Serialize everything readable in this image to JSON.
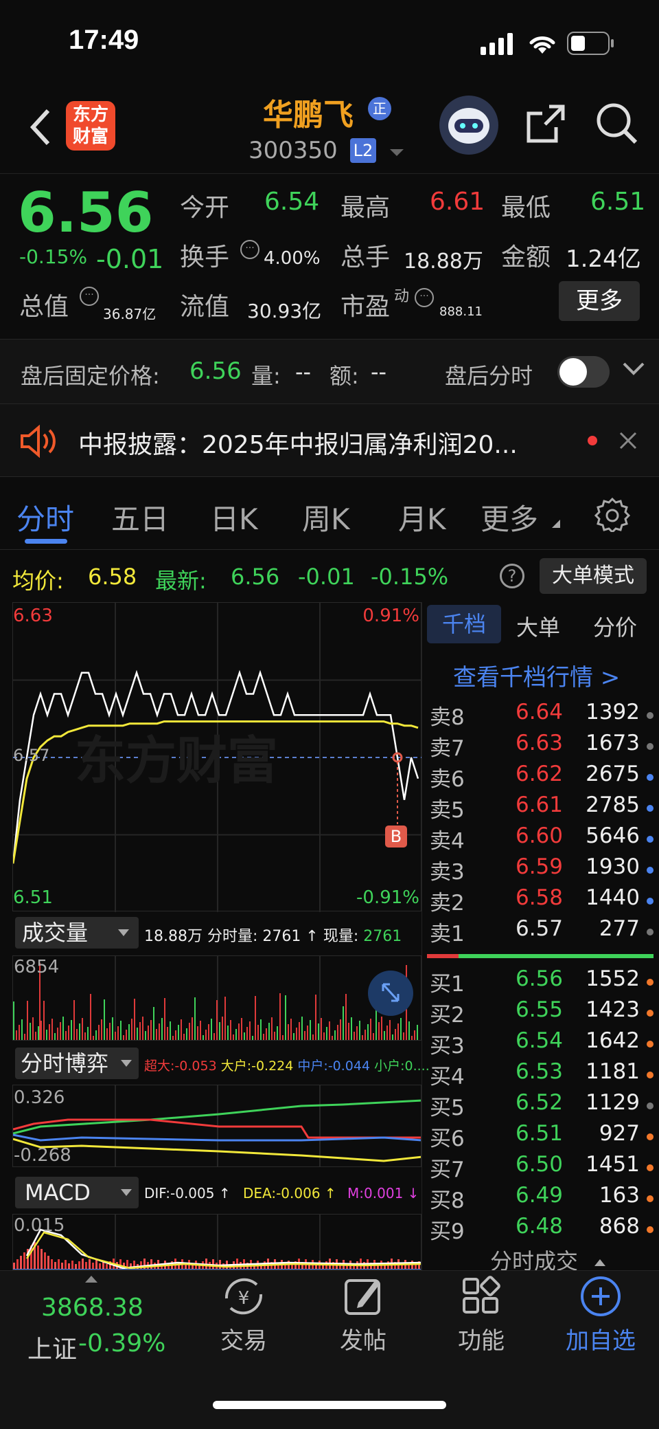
{
  "status": {
    "time": "17:49"
  },
  "header": {
    "logo_line1": "东方",
    "logo_line2": "财富",
    "stock_name": "华鹏飞",
    "badge": "正",
    "code": "300350",
    "level": "L2"
  },
  "quote": {
    "price": "6.56",
    "pct": "-0.15%",
    "chg": "-0.01",
    "open_label": "今开",
    "open": "6.54",
    "high_label": "最高",
    "high": "6.61",
    "low_label": "最低",
    "low": "6.51",
    "turnover_label": "换手",
    "turnover": "4.00%",
    "vol_label": "总手",
    "vol": "18.88万",
    "amount_label": "金额",
    "amount": "1.24亿",
    "mcap_label": "总值",
    "mcap": "36.87亿",
    "float_label": "流值",
    "float": "30.93亿",
    "pe_label": "市盈",
    "pe_sup": "动",
    "pe": "888.11",
    "more": "更多"
  },
  "afterhours": {
    "label": "盘后固定价格:",
    "price": "6.56",
    "vol_label": "量:",
    "vol": "--",
    "amt_label": "额:",
    "amt": "--",
    "fenshi": "盘后分时"
  },
  "notice": {
    "text": "中报披露：2025年中报归属净利润20..."
  },
  "tabs": [
    "分时",
    "五日",
    "日K",
    "周K",
    "月K",
    "更多"
  ],
  "infobar": {
    "avg_label": "均价:",
    "avg": "6.58",
    "latest_label": "最新:",
    "latest": "6.56",
    "chg": "-0.01",
    "pct": "-0.15%",
    "mode": "大单模式"
  },
  "chart_data": [
    {
      "type": "line",
      "title": "分时",
      "ylim": [
        6.51,
        6.63
      ],
      "y_labels": {
        "top": "6.63",
        "mid": "6.57",
        "bottom": "6.51",
        "top_pct": "0.91%",
        "bottom_pct": "-0.91%"
      },
      "series": [
        {
          "name": "price",
          "color": "#ffffff",
          "values": [
            6.52,
            6.55,
            6.57,
            6.59,
            6.6,
            6.59,
            6.6,
            6.6,
            6.59,
            6.6,
            6.61,
            6.61,
            6.6,
            6.6,
            6.59,
            6.6,
            6.59,
            6.6,
            6.61,
            6.6,
            6.6,
            6.59,
            6.6,
            6.6,
            6.59,
            6.59,
            6.6,
            6.59,
            6.59,
            6.6,
            6.59,
            6.59,
            6.6,
            6.61,
            6.6,
            6.6,
            6.61,
            6.6,
            6.59,
            6.59,
            6.6,
            6.59,
            6.59,
            6.59,
            6.59,
            6.59,
            6.59,
            6.59,
            6.59,
            6.59,
            6.59,
            6.59,
            6.6,
            6.59,
            6.59,
            6.59,
            6.57,
            6.55,
            6.57,
            6.56
          ]
        },
        {
          "name": "avg",
          "color": "#f2e83a",
          "values": [
            6.52,
            6.54,
            6.56,
            6.57,
            6.575,
            6.578,
            6.58,
            6.58,
            6.582,
            6.583,
            6.584,
            6.585,
            6.585,
            6.585,
            6.585,
            6.585,
            6.585,
            6.586,
            6.586,
            6.586,
            6.586,
            6.586,
            6.587,
            6.587,
            6.587,
            6.587,
            6.587,
            6.587,
            6.587,
            6.587,
            6.587,
            6.587,
            6.587,
            6.587,
            6.587,
            6.587,
            6.587,
            6.587,
            6.587,
            6.587,
            6.587,
            6.587,
            6.587,
            6.587,
            6.587,
            6.587,
            6.587,
            6.587,
            6.587,
            6.587,
            6.587,
            6.587,
            6.587,
            6.587,
            6.587,
            6.586,
            6.586,
            6.585,
            6.585,
            6.584
          ]
        }
      ],
      "marker": "B"
    },
    {
      "type": "bar",
      "title": "成交量",
      "ymax_label": "6854",
      "summary": "18.88万",
      "period_label": "分时量:",
      "period": "2761",
      "now_label": "现量:",
      "now": "2761"
    },
    {
      "type": "line",
      "title": "分时博弈",
      "ymax": "0.326",
      "ymin": "-0.268",
      "legend": [
        {
          "name": "超大:",
          "value": "-0.053",
          "color": "#f23b3b"
        },
        {
          "name": "大户:",
          "value": "-0.224",
          "color": "#f2e83a"
        },
        {
          "name": "中户:",
          "value": "-0.044",
          "color": "#4b84f0"
        },
        {
          "name": "小户:",
          "value": "0....",
          "color": "#3fd35a"
        }
      ]
    },
    {
      "type": "bar",
      "title": "MACD",
      "dif_label": "DIF:",
      "dif": "-0.005",
      "dea_label": "DEA:",
      "dea": "-0.006",
      "m_label": "M:",
      "m": "0.001",
      "ymax": "0.015"
    }
  ],
  "orderbook": {
    "tabs": [
      "千档",
      "大单",
      "分价"
    ],
    "link": "查看千档行情 >",
    "asks": [
      {
        "l": "卖8",
        "p": "6.64",
        "v": "1392",
        "c": "#f23b3b",
        "d": "#777"
      },
      {
        "l": "卖7",
        "p": "6.63",
        "v": "1673",
        "c": "#f23b3b",
        "d": "#777"
      },
      {
        "l": "卖6",
        "p": "6.62",
        "v": "2675",
        "c": "#f23b3b",
        "d": "#4b84f0"
      },
      {
        "l": "卖5",
        "p": "6.61",
        "v": "2785",
        "c": "#f23b3b",
        "d": "#4b84f0"
      },
      {
        "l": "卖4",
        "p": "6.60",
        "v": "5646",
        "c": "#f23b3b",
        "d": "#4b84f0"
      },
      {
        "l": "卖3",
        "p": "6.59",
        "v": "1930",
        "c": "#f23b3b",
        "d": "#4b84f0"
      },
      {
        "l": "卖2",
        "p": "6.58",
        "v": "1440",
        "c": "#f23b3b",
        "d": "#4b84f0"
      },
      {
        "l": "卖1",
        "p": "6.57",
        "v": "277",
        "c": "#e6e6e6",
        "d": "#777"
      }
    ],
    "bids": [
      {
        "l": "买1",
        "p": "6.56",
        "v": "1552",
        "c": "#3fd35a",
        "d": "#f2782a"
      },
      {
        "l": "买2",
        "p": "6.55",
        "v": "1423",
        "c": "#3fd35a",
        "d": "#f2782a"
      },
      {
        "l": "买3",
        "p": "6.54",
        "v": "1642",
        "c": "#3fd35a",
        "d": "#f2782a"
      },
      {
        "l": "买4",
        "p": "6.53",
        "v": "1181",
        "c": "#3fd35a",
        "d": "#f2782a"
      },
      {
        "l": "买5",
        "p": "6.52",
        "v": "1129",
        "c": "#3fd35a",
        "d": "#777"
      },
      {
        "l": "买6",
        "p": "6.51",
        "v": "927",
        "c": "#3fd35a",
        "d": "#f2782a"
      },
      {
        "l": "买7",
        "p": "6.50",
        "v": "1451",
        "c": "#3fd35a",
        "d": "#f2782a"
      },
      {
        "l": "买8",
        "p": "6.49",
        "v": "163",
        "c": "#3fd35a",
        "d": "#f2782a"
      },
      {
        "l": "买9",
        "p": "6.48",
        "v": "868",
        "c": "#3fd35a",
        "d": "#f2782a"
      }
    ],
    "trades_label": "分时成交"
  },
  "bottom": {
    "index_value": "3868.38",
    "index_name": "上证",
    "index_pct": "-0.39%",
    "trade": "交易",
    "post": "发帖",
    "func": "功能",
    "watch": "加自选"
  }
}
